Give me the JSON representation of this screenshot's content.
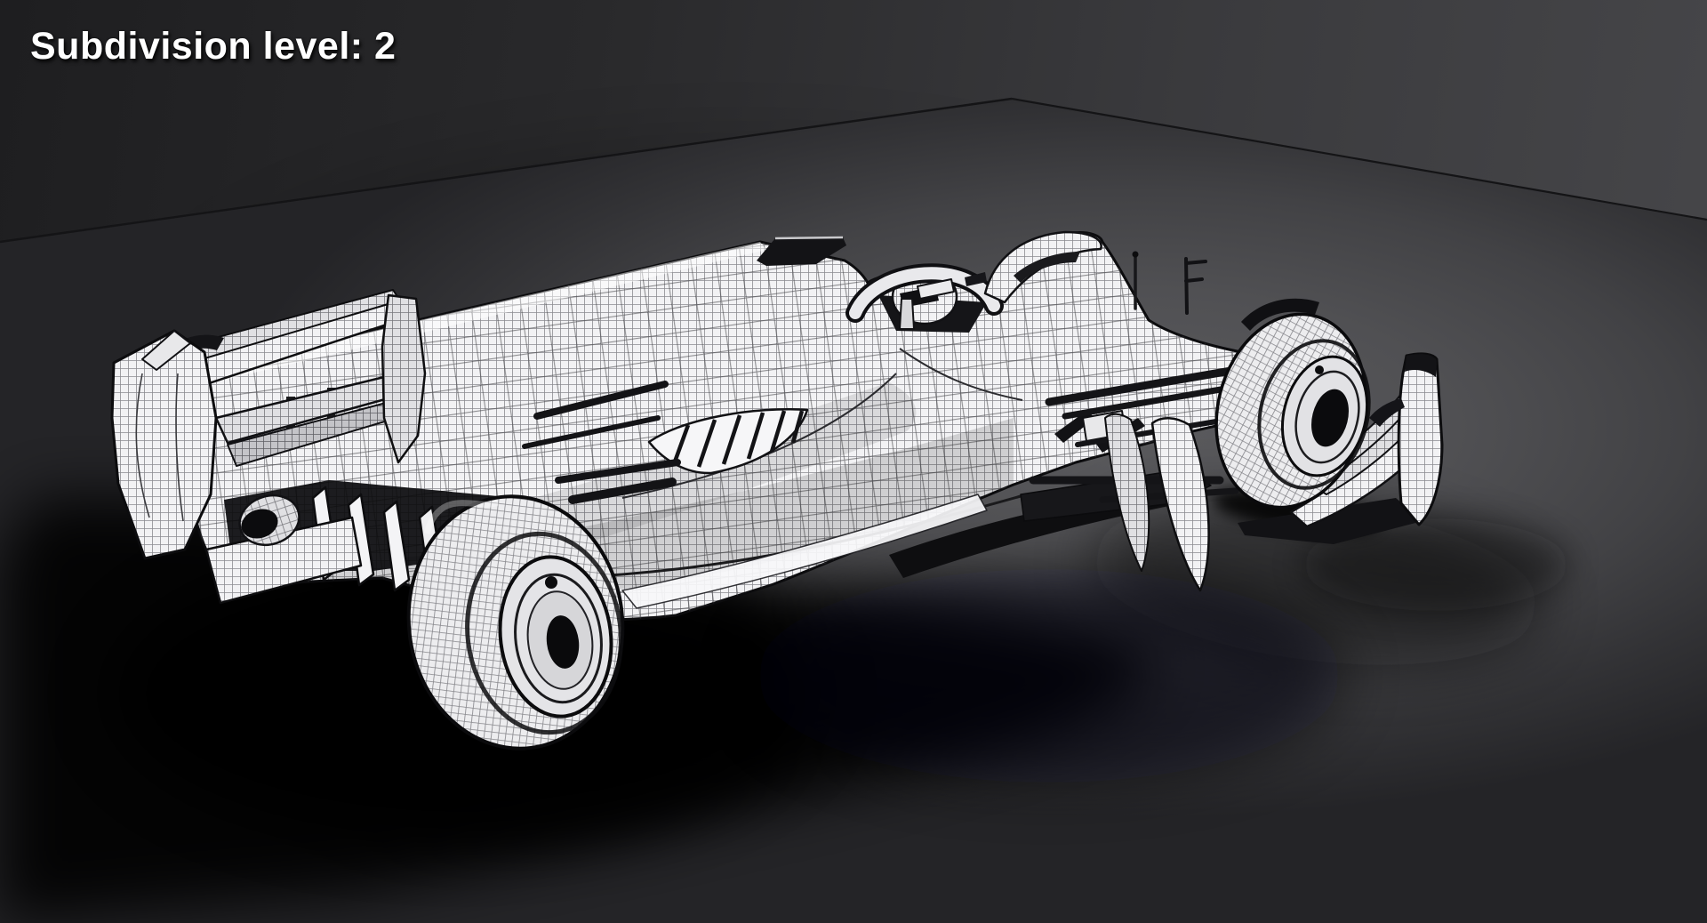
{
  "viewport": {
    "overlay_text": "Subdivision level: 2"
  },
  "colors": {
    "text": "#ffffff",
    "wall_left": "#1e1e20",
    "wall_right": "#454548",
    "floor_light": "#5b5b5e",
    "floor_dark": "#242427",
    "mesh_surface": "#f2f2f4",
    "mesh_mid": "#e0e0e3",
    "mesh_dark": "#c4c4c8",
    "wire_line": "#8b8b90",
    "outline": "#0d0d0f",
    "shadow": "#060607"
  }
}
